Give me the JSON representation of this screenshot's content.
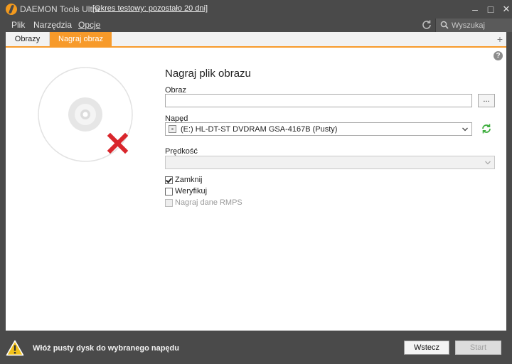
{
  "titlebar": {
    "app_title": "DAEMON Tools Ultra",
    "trial_text": "[Okres testowy: pozostało 20 dni]",
    "minimize": "–",
    "maximize": "□",
    "close": "✕"
  },
  "menu": {
    "items": [
      "Plik",
      "Narzędzia",
      "Opcje"
    ],
    "search_placeholder": "Wyszukaj"
  },
  "tabs": {
    "items": [
      "Obrazy",
      "Nagraj obraz"
    ],
    "active": "Nagraj obraz",
    "add": "+"
  },
  "content": {
    "help": "?",
    "title": "Nagraj plik obrazu",
    "image_label": "Obraz",
    "image_value": "",
    "browse_label": "...",
    "drive_label": "Napęd",
    "drive_value": "(E:) HL-DT-ST DVDRAM GSA-4167B (Pusty)",
    "speed_label": "Prędkość",
    "speed_value": "",
    "options": [
      {
        "label": "Zamknij",
        "checked": true,
        "enabled": true
      },
      {
        "label": "Weryfikuj",
        "checked": false,
        "enabled": true
      },
      {
        "label": "Nagraj dane RMPS",
        "checked": false,
        "enabled": false
      }
    ]
  },
  "statusbar": {
    "message": "Włóż pusty dysk do wybranego napędu",
    "back_label": "Wstecz",
    "start_label": "Start"
  },
  "colors": {
    "accent": "#f79a2a",
    "chrome": "#4a4a4a",
    "error_x": "#d9262c",
    "refresh_green": "#3fae3f",
    "warning_yellow": "#f2c21b"
  },
  "icons": [
    "app-logo-icon",
    "refresh-icon",
    "search-icon",
    "help-icon",
    "disc-icon",
    "error-x-icon",
    "drive-icon",
    "chevron-down-icon",
    "warning-icon"
  ]
}
